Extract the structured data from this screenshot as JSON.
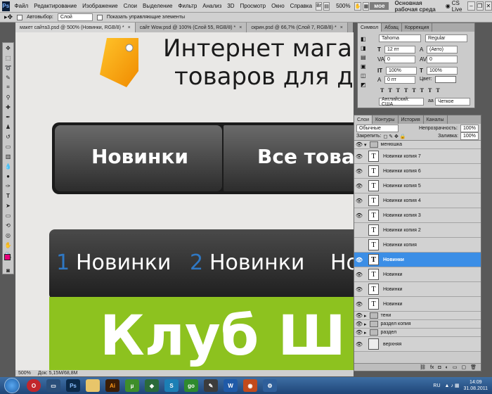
{
  "menu": {
    "items": [
      "Файл",
      "Редактирование",
      "Изображение",
      "Слои",
      "Выделение",
      "Фильтр",
      "Анализ",
      "3D",
      "Просмотр",
      "Окно",
      "Справка"
    ],
    "zoom": "500%",
    "moe": "мое",
    "workspace": "Основная рабочая среда",
    "cslive": "CS Live"
  },
  "options": {
    "autoselect": "Автовыбор:",
    "layer_value": "Слой",
    "transform": "Показать управляющие элементы"
  },
  "doc_tabs": [
    {
      "label": "макет сайта3.psd @ 500% (Новинки, RGB/8) *"
    },
    {
      "label": "сайт Wow.psd @ 100% (Слой 55, RGB/8) *"
    },
    {
      "label": "скрин.psd @ 66,7% (Слой 7, RGB/8) *"
    }
  ],
  "canvas": {
    "heading1": "Интернет магазин",
    "heading2": "товаров для дом",
    "nav1": "Новинки",
    "nav2": "Все товар",
    "num1": "1",
    "num2": "2",
    "item1": "Новинки",
    "item2": "Новинки",
    "item3": "Но",
    "big": "Клуб Ш"
  },
  "status": {
    "zoom": "500%",
    "doc": "Док: 5,15M/68,8M"
  },
  "char_panel": {
    "tabs": [
      "Символ",
      "Абзац",
      "Коррекция"
    ],
    "font": "Tahoma",
    "style": "Regular",
    "size": "12 пт",
    "leading": "(Авто)",
    "kerning": "0",
    "tracking": "0",
    "vscale": "100%",
    "hscale": "100%",
    "baseline": "0 пт",
    "color_label": "Цвет:",
    "lang": "Английский: США",
    "aa": "Четкое"
  },
  "layers_panel": {
    "tabs": [
      "Слои",
      "Контуры",
      "История",
      "Каналы"
    ],
    "blend": "Обычные",
    "opacity_label": "Непрозрачность:",
    "opacity": "100%",
    "lock_label": "Закрепить:",
    "fill_label": "Заливка:",
    "fill": "100%",
    "group_open": "менюшка",
    "text_layers": [
      "Новинки копия 7",
      "Новинки копия 6",
      "Новинки копия 5",
      "Новинки копия 4",
      "Новинки копия 3",
      "Новинки копия 2",
      "Новинки копия",
      "Новинки",
      "Новинки",
      "Новинки",
      "Новинки"
    ],
    "groups": [
      "тени",
      "раздел копия",
      "раздел"
    ],
    "last_layer": "верхняя"
  },
  "taskbar": {
    "lang": "RU",
    "time": "14:09",
    "date": "31.08.2011",
    "apps": [
      "Ps",
      "Ai",
      "W"
    ]
  },
  "colors": {
    "fg": "#e8007a",
    "active_layer": "#3b8ee6",
    "green": "#8dc21f"
  }
}
